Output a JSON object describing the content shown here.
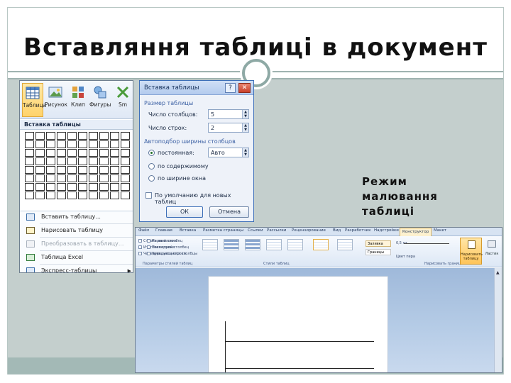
{
  "slide": {
    "title": "Вставляння таблиці в документ",
    "caption_lines": [
      "Режим",
      "малювання",
      "таблиці"
    ]
  },
  "insert_menu": {
    "ribbon_buttons": [
      "Таблица",
      "Рисунок",
      "Клип",
      "Фигуры",
      "Sm"
    ],
    "grid_header": "Вставка таблицы",
    "grid_cols": 10,
    "grid_rows": 8,
    "items": [
      {
        "label": "Вставить таблицу...",
        "disabled": false,
        "has_arrow": false
      },
      {
        "label": "Нарисовать таблицу",
        "disabled": false,
        "has_arrow": false
      },
      {
        "label": "Преобразовать в таблицу...",
        "disabled": true,
        "has_arrow": false
      },
      {
        "label": "Таблица Excel",
        "disabled": false,
        "has_arrow": false
      },
      {
        "label": "Экспресс-таблицы",
        "disabled": false,
        "has_arrow": true
      }
    ]
  },
  "dialog": {
    "title": "Вставка таблицы",
    "help": "?",
    "close": "✕",
    "size_group": "Размер таблицы",
    "cols_label": "Число столбцов:",
    "cols_value": "5",
    "rows_label": "Число строк:",
    "rows_value": "2",
    "autofit_group": "Автоподбор ширины столбцов",
    "radio_fixed": "постоянная:",
    "fixed_value": "Авто",
    "radio_content": "по содержимому",
    "radio_window": "по ширине окна",
    "default_check": "По умолчанию для новых таблиц",
    "ok": "ОК",
    "cancel": "Отмена"
  },
  "word": {
    "tabs": [
      "Файл",
      "Главная",
      "Вставка",
      "Разметка страницы",
      "Ссылки",
      "Рассылки",
      "Рецензирование",
      "Вид",
      "Разработчик",
      "Надстройки",
      "Конструктор",
      "Макет"
    ],
    "active_tab": "Конструктор",
    "checkboxes": [
      "Строка заголовка",
      "Итоговая строка",
      "Чередующиеся строки"
    ],
    "checkboxes_right": [
      "Первый столбец",
      "Последний столбец",
      "Чередующиеся столбцы"
    ],
    "group_style_options": "Параметры стилей таблиц",
    "group_styles": "Стили таблиц",
    "group_draw": "Нарисовать границы",
    "fill": "Заливка",
    "borders": "Границы",
    "pen_weight": "0,5 пт",
    "pen_color": "Цвет пера",
    "draw_table": "Нарисовать таблицу",
    "eraser": "Ластик"
  }
}
